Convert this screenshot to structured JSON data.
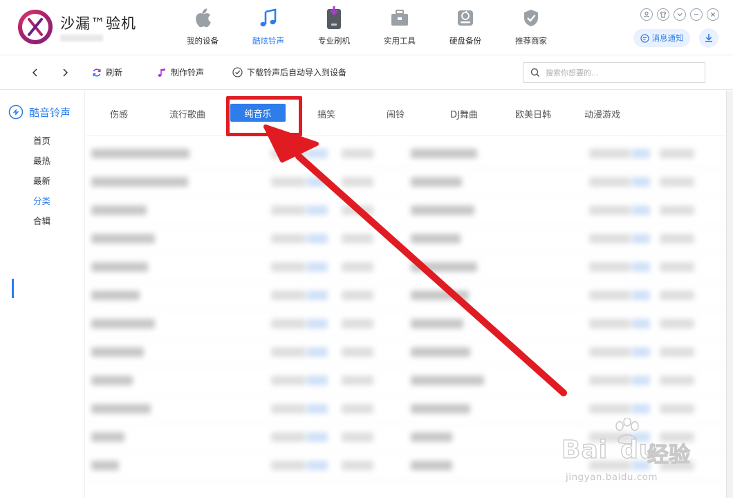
{
  "app": {
    "brand": "沙漏™验机"
  },
  "top_nav": [
    {
      "label": "我的设备",
      "icon": "apple-icon",
      "active": false
    },
    {
      "label": "酷炫铃声",
      "icon": "music-note-icon",
      "active": true
    },
    {
      "label": "专业刷机",
      "icon": "phone-flash-icon",
      "active": false
    },
    {
      "label": "实用工具",
      "icon": "toolbox-icon",
      "active": false
    },
    {
      "label": "硬盘备份",
      "icon": "disk-backup-icon",
      "active": false
    },
    {
      "label": "推荐商家",
      "icon": "shield-check-icon",
      "active": false
    }
  ],
  "window_controls": {
    "notice_label": "消息通知"
  },
  "toolbar": {
    "refresh_label": "刷新",
    "make_ringtone_label": "制作铃声",
    "auto_import_label": "下载铃声后自动导入到设备",
    "search_placeholder": "搜索你想要的..."
  },
  "sidebar": {
    "title": "酷音铃声",
    "items": [
      {
        "label": "首页",
        "active": false
      },
      {
        "label": "最热",
        "active": false
      },
      {
        "label": "最新",
        "active": false
      },
      {
        "label": "分类",
        "active": true
      },
      {
        "label": "合辑",
        "active": false
      }
    ]
  },
  "categories": {
    "tabs": [
      "伤感",
      "流行歌曲",
      "纯音乐",
      "搞笑",
      "闹铃",
      "DJ舞曲",
      "欧美日韩",
      "动漫游戏"
    ],
    "active": "纯音乐"
  },
  "colors": {
    "accent": "#2e7dea",
    "annotation": "#e11b22"
  },
  "watermark": {
    "brand_latin": "Bai",
    "brand_latin_tail": "du",
    "brand_cn": "经验",
    "url": "jingyan.baidu.com"
  }
}
